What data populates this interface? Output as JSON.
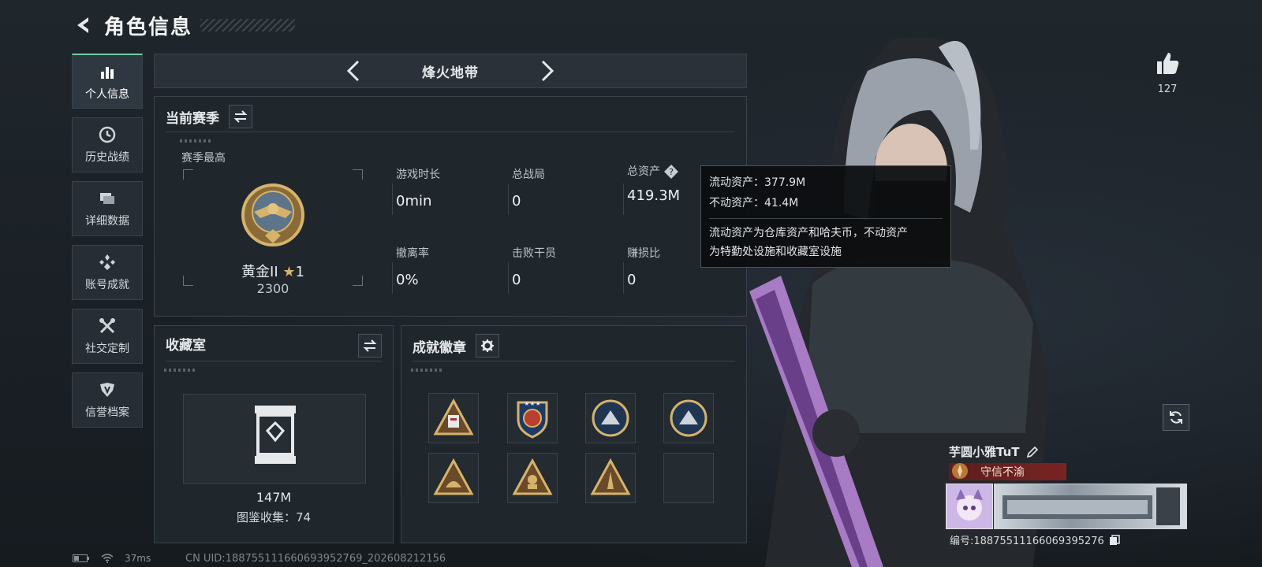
{
  "header": {
    "title": "角色信息"
  },
  "nav": {
    "items": [
      {
        "label": "个人信息",
        "icon": "bar-chart-icon",
        "active": true
      },
      {
        "label": "历史战绩",
        "icon": "clock-icon"
      },
      {
        "label": "详细数据",
        "icon": "cards-icon"
      },
      {
        "label": "账号成就",
        "icon": "achievement-icon"
      },
      {
        "label": "社交定制",
        "icon": "tools-icon"
      },
      {
        "label": "信誉档案",
        "icon": "shield-icon"
      }
    ]
  },
  "mode": {
    "title": "烽火地带"
  },
  "season": {
    "title": "当前赛季",
    "best_label": "赛季最高",
    "rank_name": "黄金II",
    "rank_stars": "1",
    "rank_score": "2300",
    "stats": [
      {
        "label": "游戏时长",
        "value": "0min"
      },
      {
        "label": "总战局",
        "value": "0"
      },
      {
        "label": "总资产",
        "value": "419.3M"
      },
      {
        "label": "撤离率",
        "value": "0%"
      },
      {
        "label": "击败干员",
        "value": "0"
      },
      {
        "label": "赚损比",
        "value": "0"
      }
    ]
  },
  "tooltip": {
    "liquid": "流动资产：377.9M",
    "fixed": "不动资产：41.4M",
    "desc_line1": "流动资产为仓库资产和哈夫币，不动资产",
    "desc_line2": "为特勤处设施和收藏室设施"
  },
  "collection": {
    "title": "收藏室",
    "value": "147M",
    "count": "图鉴收集：74"
  },
  "badges": {
    "title": "成就徽章",
    "items": [
      "triangle-badge",
      "star-shield-badge",
      "navy-round-badge",
      "navy-round-badge",
      "triangle-badge",
      "triangle-badge",
      "triangle-badge",
      "empty-slot"
    ]
  },
  "likes": {
    "count": "127"
  },
  "player": {
    "name": "芋圆小雅TuT",
    "title": "守信不渝",
    "id": "编号:18875511166069395276"
  },
  "status": {
    "ping": "37ms"
  },
  "footer": {
    "uid": "CN UID:18875511166069395276​9_202608212156"
  },
  "colors": {
    "accent": "#6fd0a0",
    "gold": "#c49a4a",
    "tag": "#7a2323"
  }
}
